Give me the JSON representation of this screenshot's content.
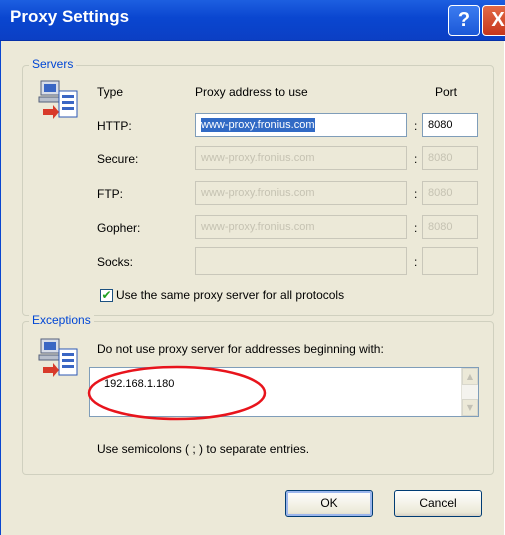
{
  "window": {
    "title": "Proxy Settings",
    "help_symbol": "?",
    "close_symbol": "X"
  },
  "servers": {
    "group_label": "Servers",
    "col_type": "Type",
    "col_address": "Proxy address to use",
    "col_port": "Port",
    "rows": [
      {
        "type": "HTTP:",
        "address": "www-proxy.fronius.com",
        "port": "8080",
        "enabled": true
      },
      {
        "type": "Secure:",
        "address": "www-proxy.fronius.com",
        "port": "8080",
        "enabled": false
      },
      {
        "type": "FTP:",
        "address": "www-proxy.fronius.com",
        "port": "8080",
        "enabled": false
      },
      {
        "type": "Gopher:",
        "address": "www-proxy.fronius.com",
        "port": "8080",
        "enabled": false
      },
      {
        "type": "Socks:",
        "address": "",
        "port": "",
        "enabled": false
      }
    ],
    "colon": ":",
    "same_proxy_label": "Use the same proxy server for all protocols",
    "same_proxy_checked": true
  },
  "exceptions": {
    "group_label": "Exceptions",
    "description": "Do not use proxy server for addresses beginning with:",
    "value": "192.168.1.180",
    "hint": "Use semicolons ( ; ) to separate entries."
  },
  "buttons": {
    "ok": "OK",
    "cancel": "Cancel"
  },
  "colors": {
    "titlebar": "#0a46d0",
    "group_label": "#0046d5",
    "highlight_circle": "#e8141c"
  }
}
